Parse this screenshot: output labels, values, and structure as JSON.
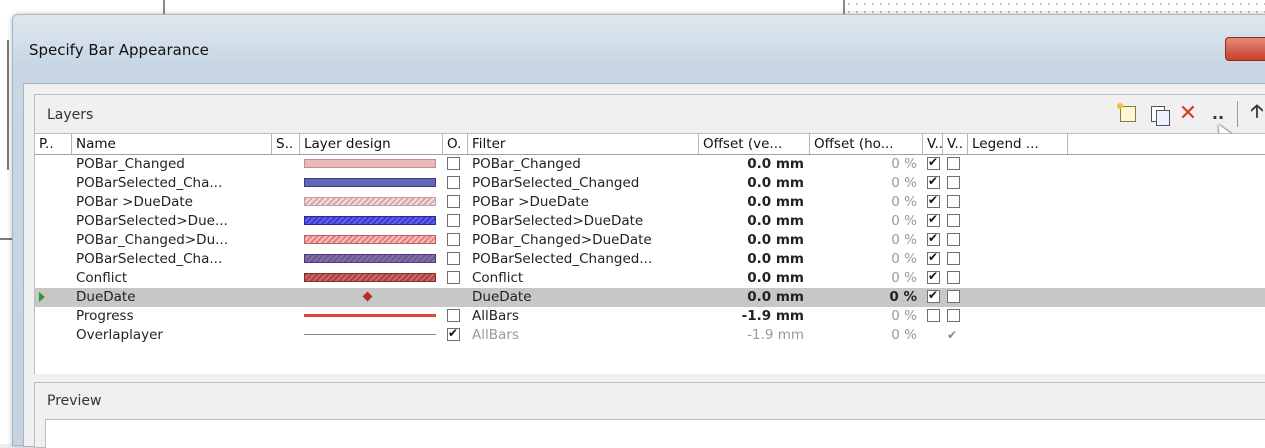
{
  "dialog": {
    "title": "Specify Bar Appearance"
  },
  "layers": {
    "label": "Layers",
    "columns": {
      "p": "P..",
      "name": "Name",
      "s": "S..",
      "design": "Layer design",
      "o": "O.",
      "filter": "Filter",
      "offset_v": "Offset (ve...",
      "offset_h": "Offset (ho...",
      "v1": "V..",
      "v2": "V..",
      "legend": "Legend ..."
    },
    "rows": [
      {
        "name": "POBar_Changed",
        "design": "pink",
        "o": false,
        "filter": "POBar_Changed",
        "offset_v": "0.0 mm",
        "offset_h": "0 %",
        "v1": true,
        "v2": false
      },
      {
        "name": "POBarSelected_Cha...",
        "design": "sel",
        "o": false,
        "filter": "POBarSelected_Changed",
        "offset_v": "0.0 mm",
        "offset_h": "0 %",
        "v1": true,
        "v2": false
      },
      {
        "name": "POBar >DueDate",
        "design": "hatch-pink",
        "o": false,
        "filter": "POBar >DueDate",
        "offset_v": "0.0 mm",
        "offset_h": "0 %",
        "v1": true,
        "v2": false
      },
      {
        "name": "POBarSelected>Due...",
        "design": "hatch-blue",
        "o": false,
        "filter": "POBarSelected>DueDate",
        "offset_v": "0.0 mm",
        "offset_h": "0 %",
        "v1": true,
        "v2": false
      },
      {
        "name": "POBar_Changed>Du...",
        "design": "hatch-pink2",
        "o": false,
        "filter": "POBar_Changed>DueDate",
        "offset_v": "0.0 mm",
        "offset_h": "0 %",
        "v1": true,
        "v2": false
      },
      {
        "name": "POBarSelected_Cha...",
        "design": "hatch-sel",
        "o": false,
        "filter": "POBarSelected_Changed...",
        "offset_v": "0.0 mm",
        "offset_h": "0 %",
        "v1": true,
        "v2": false
      },
      {
        "name": "Conflict",
        "design": "conflict",
        "o": false,
        "filter": "Conflict",
        "offset_v": "0.0 mm",
        "offset_h": "0 %",
        "v1": true,
        "v2": false
      },
      {
        "name": "DueDate",
        "design": "diamond",
        "o": null,
        "filter": "DueDate",
        "offset_v": "0.0 mm",
        "offset_h": "0 %",
        "v1": true,
        "v2": false,
        "selected": true
      },
      {
        "name": "Progress",
        "design": "progress",
        "o": false,
        "filter": "AllBars",
        "offset_v": "-1.9 mm",
        "offset_h": "0 %",
        "v1": false,
        "v2": false
      },
      {
        "name": "Overlaplayer",
        "design": "overlap",
        "o": true,
        "filter": "AllBars",
        "offset_v": "-1.9 mm",
        "offset_h": "0 %",
        "v1": null,
        "v2": "check",
        "muted": true
      }
    ]
  },
  "preview": {
    "label": "Preview"
  },
  "colors": {
    "selected_row": "#c7c7c7",
    "delete": "#d23b2a",
    "marker": "#2a9a2a"
  }
}
